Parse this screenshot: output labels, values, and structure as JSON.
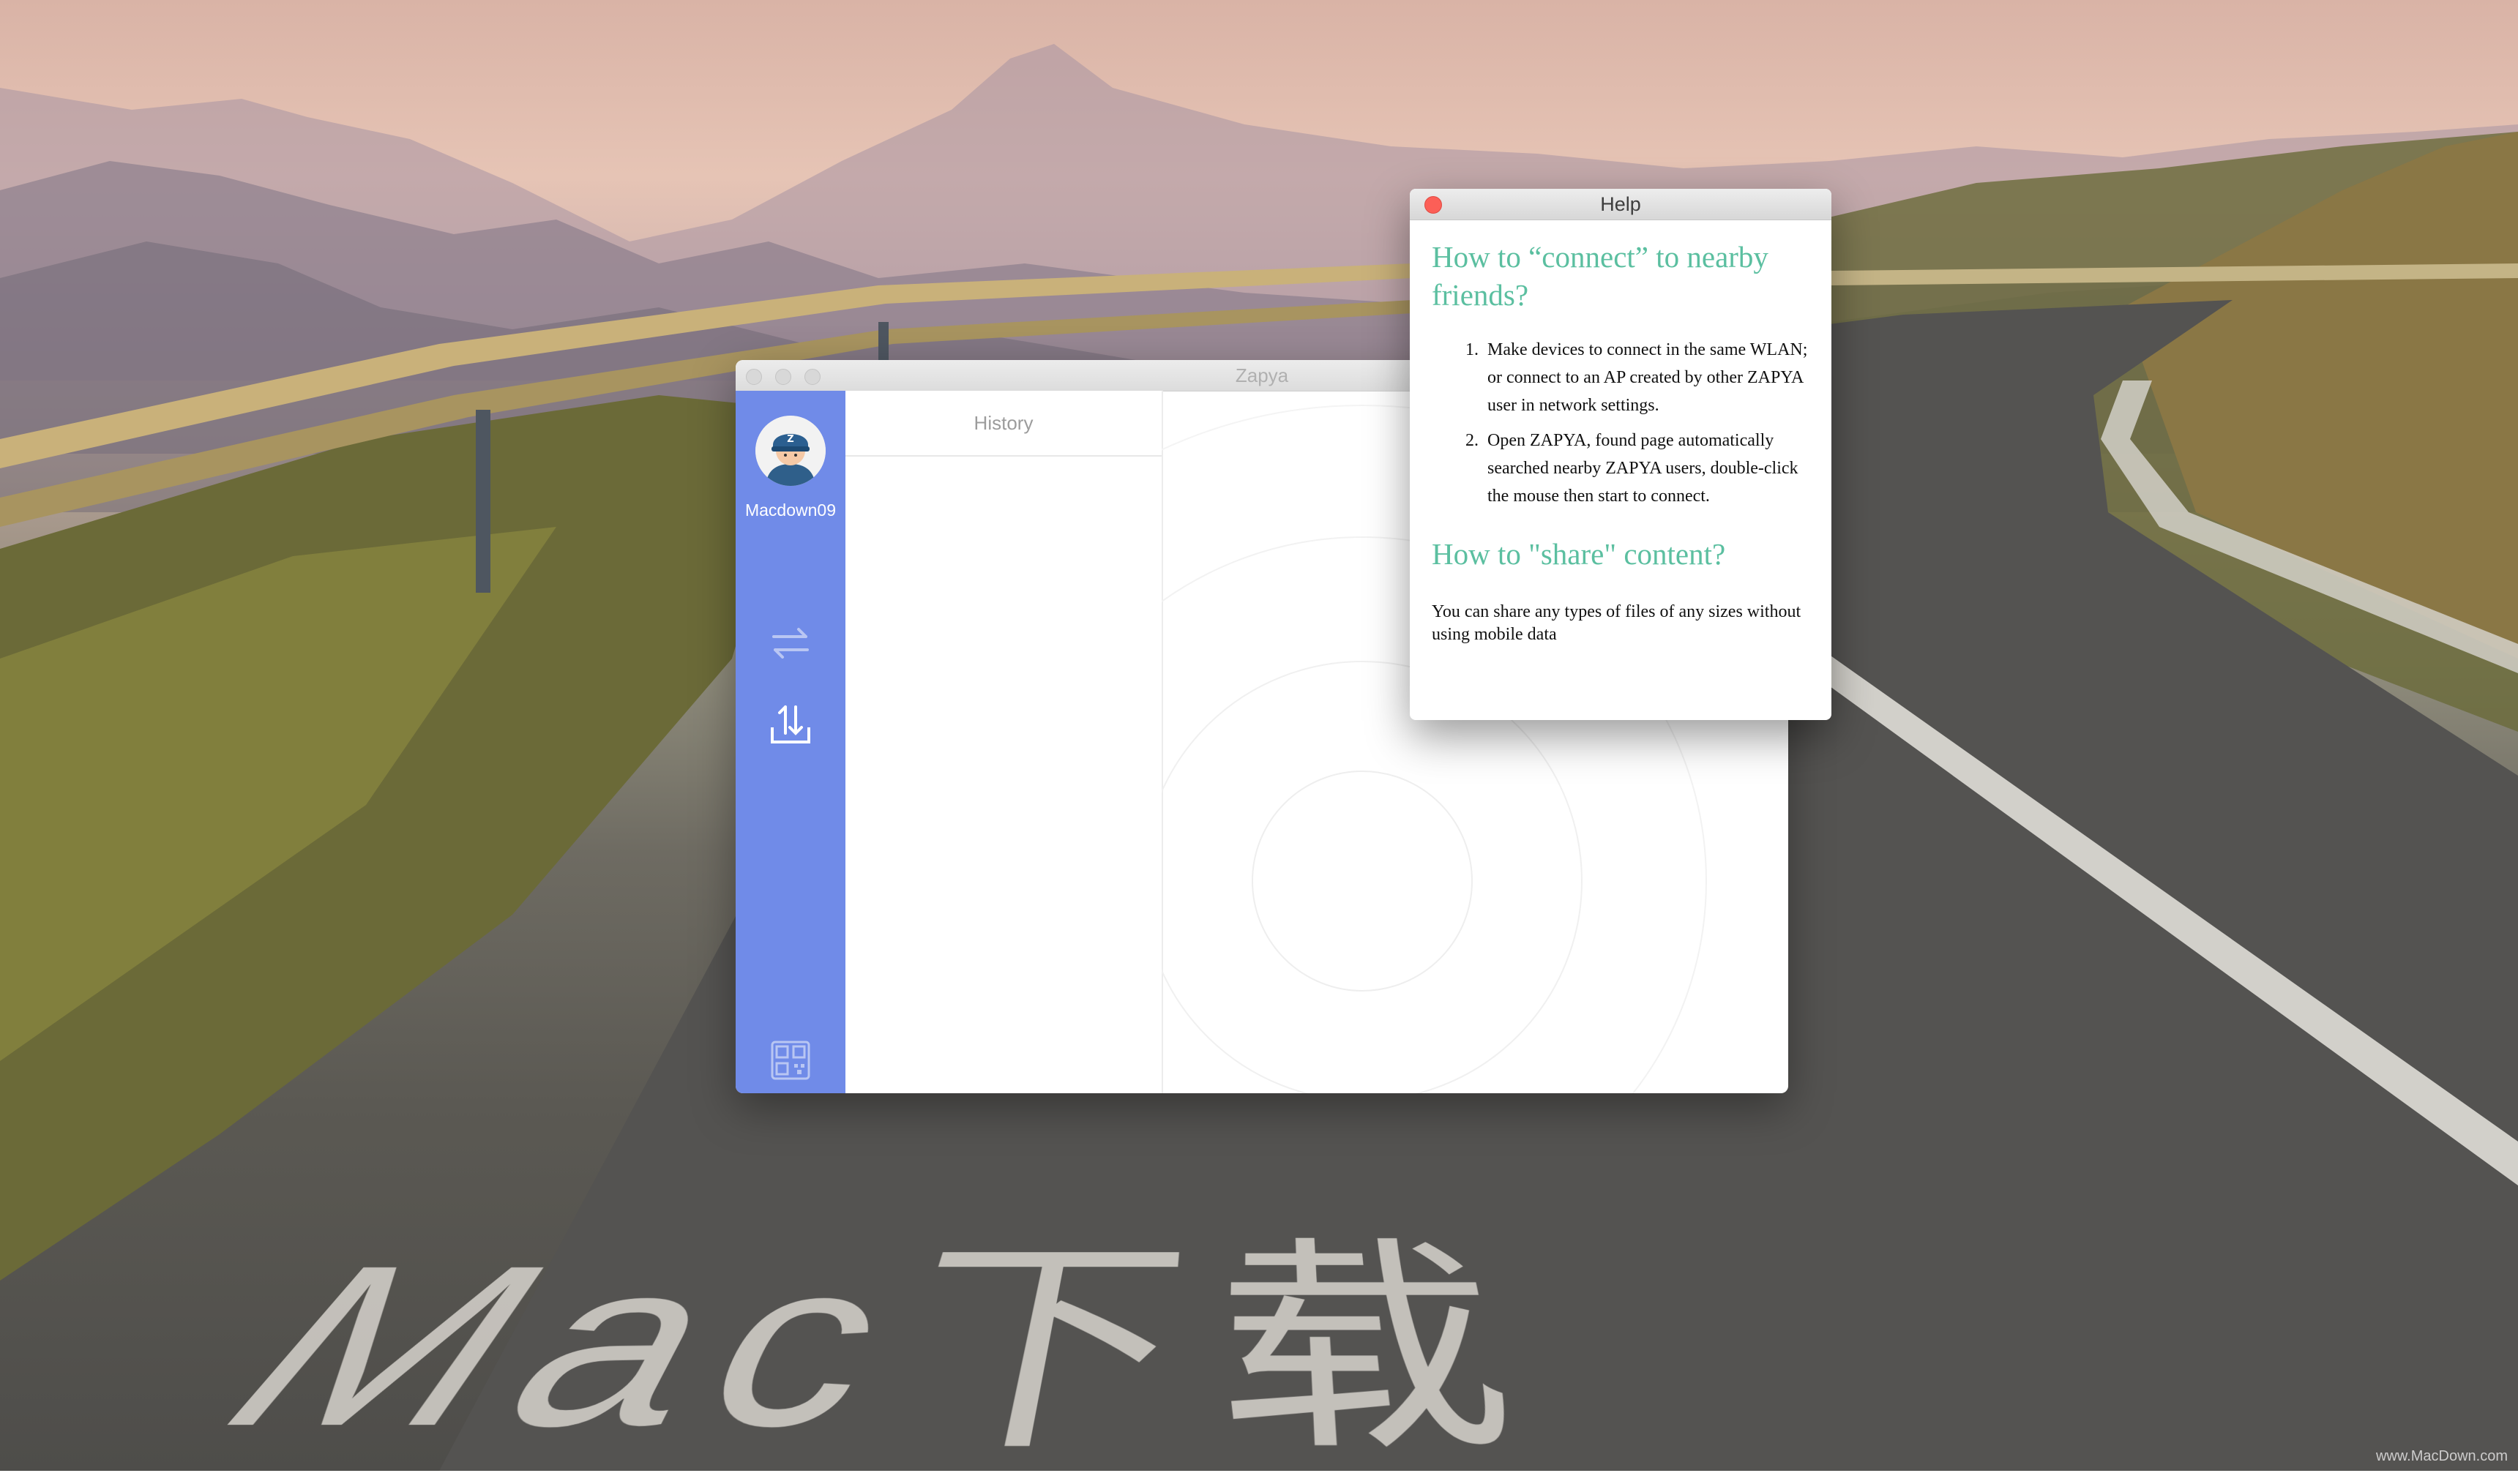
{
  "zapya_window": {
    "title": "Zapya",
    "username": "Macdown09",
    "history_label": "History",
    "icons": [
      "transfer-arrows-icon",
      "upload-tray-icon",
      "qr-code-icon"
    ],
    "accent_color": "#708be8"
  },
  "help_window": {
    "title": "Help",
    "heading_connect": "How to “connect” to nearby friends?",
    "steps": [
      "Make devices to connect in the same WLAN; or connect to an AP created by other ZAPYA user in network settings.",
      "Open ZAPYA, found page automatically searched nearby ZAPYA users, double-click the mouse then start to connect."
    ],
    "heading_share": "How to \"share\" content?",
    "share_text": "You can share any types of files of any sizes without using mobile data",
    "heading_color": "#5bbfa0"
  },
  "desktop": {
    "road_text": "Mac下载",
    "watermark": "www.MacDown.com"
  }
}
